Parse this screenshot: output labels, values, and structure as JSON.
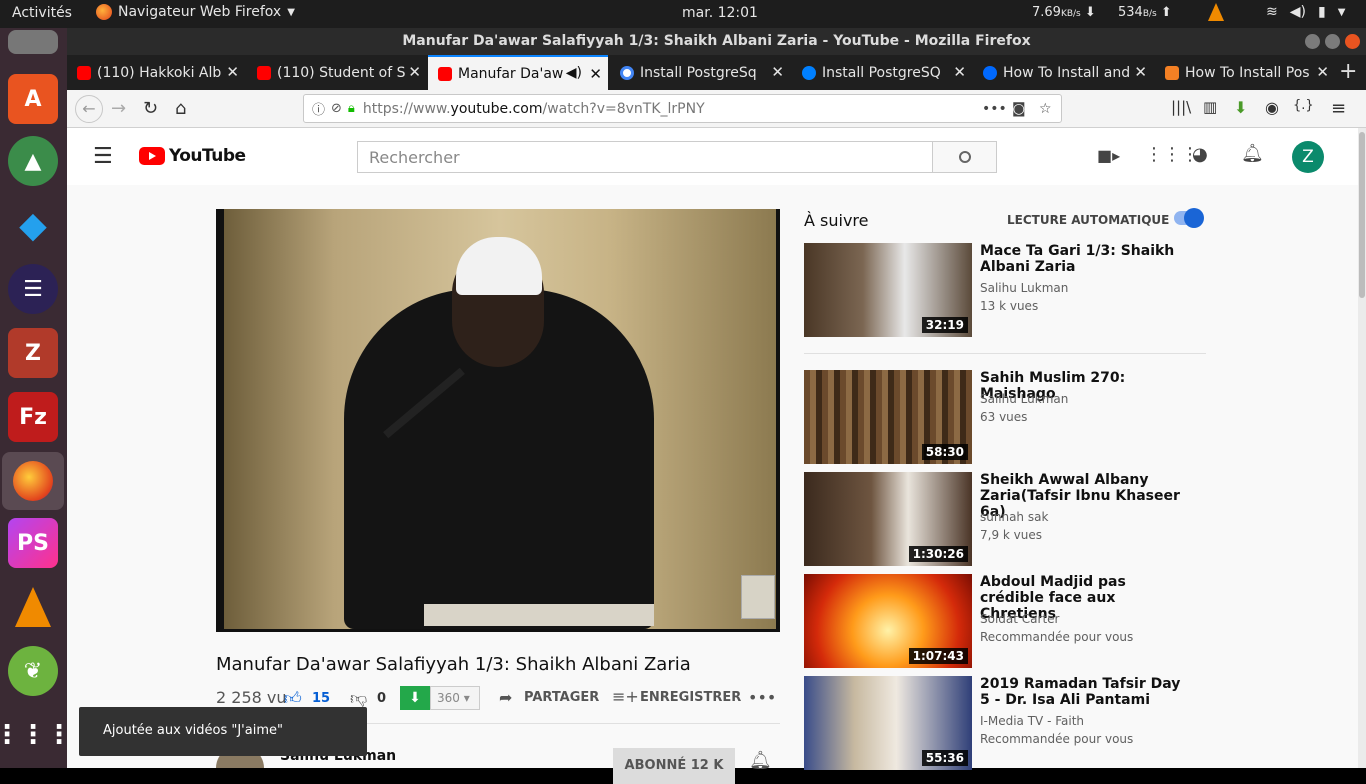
{
  "system": {
    "activities": "Activités",
    "app_menu": "Navigateur Web Firefox",
    "clock": "mar. 12:01",
    "net_down": "7.69",
    "net_down_unit": "KB/s",
    "net_up": "534",
    "net_up_unit": "B/s"
  },
  "window": {
    "title": "Manufar Da'awar Salafiyyah 1/3: Shaikh Albani Zaria - YouTube - Mozilla Firefox"
  },
  "tabs": [
    {
      "label": "(110) Hakkoki Alb",
      "favicon": "youtube"
    },
    {
      "label": "(110) Student of S",
      "favicon": "youtube"
    },
    {
      "label": "Manufar Da'aw",
      "favicon": "youtube",
      "active": true
    },
    {
      "label": "Install PostgreSq",
      "favicon": "google"
    },
    {
      "label": "Install PostgreSQ",
      "favicon": "digitalocean"
    },
    {
      "label": "How To Install and",
      "favicon": "digitalocean"
    },
    {
      "label": "How To Install Pos",
      "favicon": "stackoverflow"
    }
  ],
  "nav": {
    "url_prefix": "https://www.",
    "url_host": "youtube.com",
    "url_path": "/watch?v=8vnTK_lrPNY",
    "more": "•••"
  },
  "youtube": {
    "logo": "YouTube",
    "search_placeholder": "Rechercher",
    "avatar_letter": "Z"
  },
  "video": {
    "title": "Manufar Da'awar Salafiyyah 1/3: Shaikh Albani Zaria",
    "views": "2 258 vu",
    "likes": "15",
    "dislikes": "0",
    "download_count": "360",
    "share_label": "PARTAGER",
    "save_label": "ENREGISTRER",
    "more": "•••",
    "channel": "Salihu Lukman",
    "subscribe_label": "ABONNÉ 12 K"
  },
  "sidebar": {
    "up_next": "À suivre",
    "autoplay_label": "LECTURE AUTOMATIQUE",
    "autoplay_on": true,
    "items": [
      {
        "title": "Mace Ta Gari 1/3: Shaikh Albani Zaria",
        "channel": "Salihu Lukman",
        "views": "13 k vues",
        "duration": "32:19"
      },
      {
        "title": "Sahih Muslim 270: Maishago",
        "channel": "Salihu Lukman",
        "views": "63 vues",
        "duration": "58:30"
      },
      {
        "title": "Sheikh Awwal Albany Zaria(Tafsir Ibnu Khaseer 6a)",
        "channel": "sunnah sak",
        "views": "7,9 k vues",
        "duration": "1:30:26"
      },
      {
        "title": "Abdoul Madjid pas crédible face aux Chretiens",
        "channel": "Soldat Carter",
        "views": "Recommandée pour vous",
        "duration": "1:07:43"
      },
      {
        "title": "2019 Ramadan Tafsir Day 5 - Dr. Isa Ali Pantami",
        "channel": "I-Media TV - Faith",
        "views": "Recommandée pour vous",
        "duration": "55:36"
      }
    ]
  },
  "toast": {
    "message": "Ajoutée aux vidéos \"J'aime\""
  }
}
